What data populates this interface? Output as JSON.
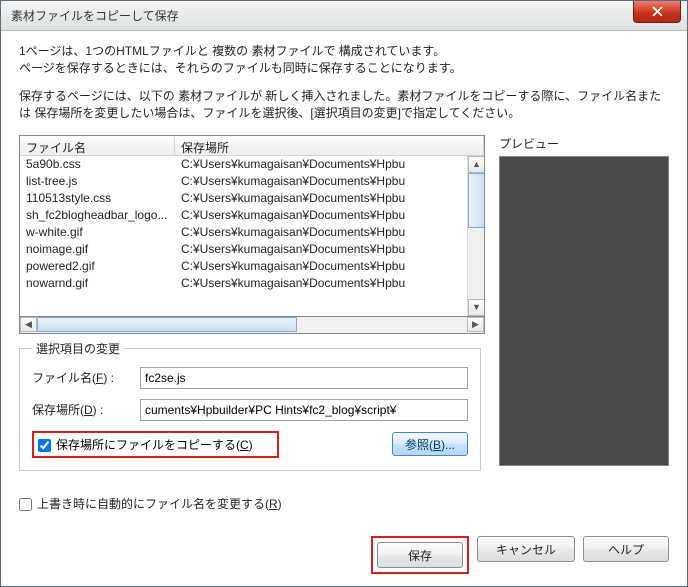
{
  "titlebar": {
    "title": "素材ファイルをコピーして保存"
  },
  "intro": {
    "line1": "1ページは、1つのHTMLファイルと 複数の 素材ファイルで 構成されています。",
    "line2": "ページを保存するときには、それらのファイルも同時に保存することになります。"
  },
  "desc": "保存するページには、以下の 素材ファイルが 新しく挿入されました。素材ファイルをコピーする際に、ファイル名または 保存場所を変更したい場合は、ファイルを選択後、[選択項目の変更]で指定してください。",
  "table": {
    "headers": {
      "name": "ファイル名",
      "location": "保存場所"
    },
    "rows": [
      {
        "name": "5a90b.css",
        "location": "C:¥Users¥kumagaisan¥Documents¥Hpbu"
      },
      {
        "name": "list-tree.js",
        "location": "C:¥Users¥kumagaisan¥Documents¥Hpbu"
      },
      {
        "name": "110513style.css",
        "location": "C:¥Users¥kumagaisan¥Documents¥Hpbu"
      },
      {
        "name": "sh_fc2blogheadbar_logo...",
        "location": "C:¥Users¥kumagaisan¥Documents¥Hpbu"
      },
      {
        "name": "w-white.gif",
        "location": "C:¥Users¥kumagaisan¥Documents¥Hpbu"
      },
      {
        "name": "noimage.gif",
        "location": "C:¥Users¥kumagaisan¥Documents¥Hpbu"
      },
      {
        "name": "powered2.gif",
        "location": "C:¥Users¥kumagaisan¥Documents¥Hpbu"
      },
      {
        "name": "nowarnd.gif",
        "location": "C:¥Users¥kumagaisan¥Documents¥Hpbu"
      }
    ]
  },
  "preview": {
    "label": "プレビュー"
  },
  "change": {
    "legend": "選択項目の変更",
    "filename_label_pre": "ファイル名(",
    "filename_label_key": "F",
    "filename_label_post": ") :",
    "filename_value": "fc2se.js",
    "location_label_pre": "保存場所(",
    "location_label_key": "D",
    "location_label_post": ") :",
    "location_value": "cuments¥Hpbuilder¥PC Hints¥fc2_blog¥script¥",
    "copy_checkbox_pre": "保存場所にファイルをコピーする(",
    "copy_checkbox_key": "C",
    "copy_checkbox_post": ")",
    "browse_pre": "参照(",
    "browse_key": "B",
    "browse_post": ")..."
  },
  "auto_rename": {
    "pre": "上書き時に自動的にファイル名を変更する(",
    "key": "R",
    "post": ")"
  },
  "buttons": {
    "save": "保存",
    "cancel": "キャンセル",
    "help": "ヘルプ"
  }
}
